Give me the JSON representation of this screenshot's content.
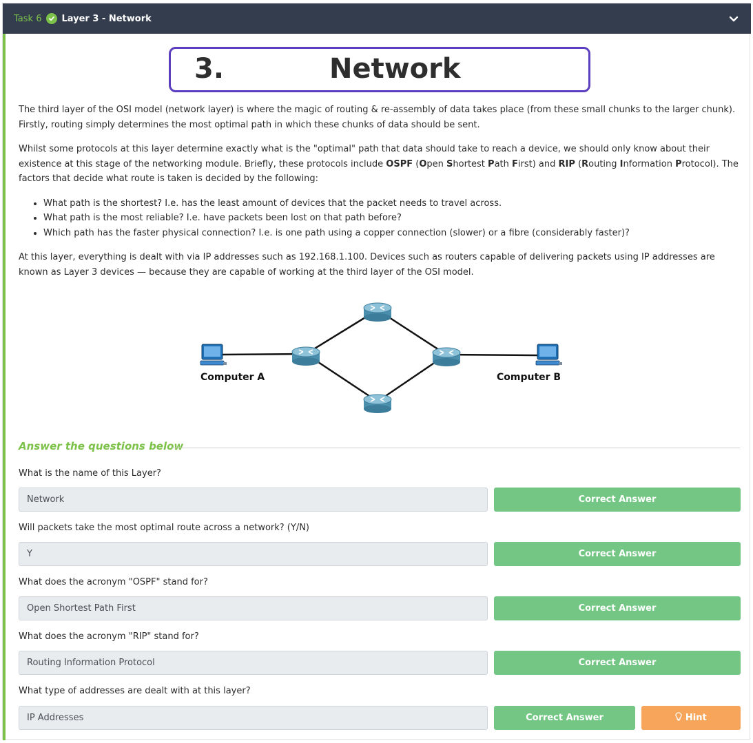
{
  "header": {
    "task_label": "Task 6",
    "title": "Layer 3 - Network",
    "accent_color": "#7cc249",
    "background_color": "#343d4e"
  },
  "banner": {
    "number": "3.",
    "title": "Network",
    "border_color": "#5b3fbf"
  },
  "intro": {
    "p1": "The third layer of the OSI model (network layer) is where the magic of routing & re-assembly of data takes place (from these small chunks to the larger chunk). Firstly, routing simply determines the most optimal path in which these chunks of data should be sent.",
    "p2_a": "Whilst some protocols at this layer determine exactly what is the \"optimal\" path that data should take to reach a device, we should only know about their existence at this stage of the networking module. Briefly, these protocols include ",
    "ospf": "OSPF",
    "p2_b": " (",
    "ospf_o": "O",
    "ospf_o_rest": "pen ",
    "ospf_s": "S",
    "ospf_s_rest": "hortest ",
    "ospf_p": "P",
    "ospf_p_rest": "ath ",
    "ospf_f": "F",
    "ospf_f_rest": "irst) and ",
    "rip": "RIP",
    "p2_c": " (",
    "rip_r": "R",
    "rip_r_rest": "outing ",
    "rip_i": "I",
    "rip_i_rest": "nformation ",
    "rip_p": "P",
    "rip_p_rest": "rotocol). The factors that decide what route is taken is decided by the following:",
    "bullets": [
      "What path is the shortest? I.e. has the least amount of devices that the packet needs to travel across.",
      "What path is the most reliable? I.e. have packets been lost on that path before?",
      "Which path has the faster physical connection? I.e. is one path using a copper connection (slower) or a fibre (considerably faster)?"
    ],
    "p3": "At this layer, everything is dealt with via IP addresses such as 192.168.1.100. Devices such as routers capable of delivering packets using IP addresses are known as Layer 3 devices — because they are capable of working at the third layer of the OSI model."
  },
  "diagram": {
    "computer_a": "Computer A",
    "computer_b": "Computer B",
    "icons": [
      "computer-icon",
      "router-icon"
    ]
  },
  "answers": {
    "heading": "Answer the questions below",
    "correct_label": "Correct Answer",
    "hint_label": "Hint",
    "correct_color": "#73c683",
    "hint_color": "#f7a55a",
    "questions": [
      {
        "question": "What is the name of this Layer?",
        "answer": "Network"
      },
      {
        "question": "Will packets take the most optimal route across a network? (Y/N)",
        "answer": "Y"
      },
      {
        "question": "What does the acronym \"OSPF\" stand for?",
        "answer": "Open Shortest Path First"
      },
      {
        "question": "What does the acronym \"RIP\" stand for?",
        "answer": "Routing Information Protocol"
      },
      {
        "question": "What type of addresses are dealt with at this layer?",
        "answer": "IP Addresses"
      }
    ]
  }
}
